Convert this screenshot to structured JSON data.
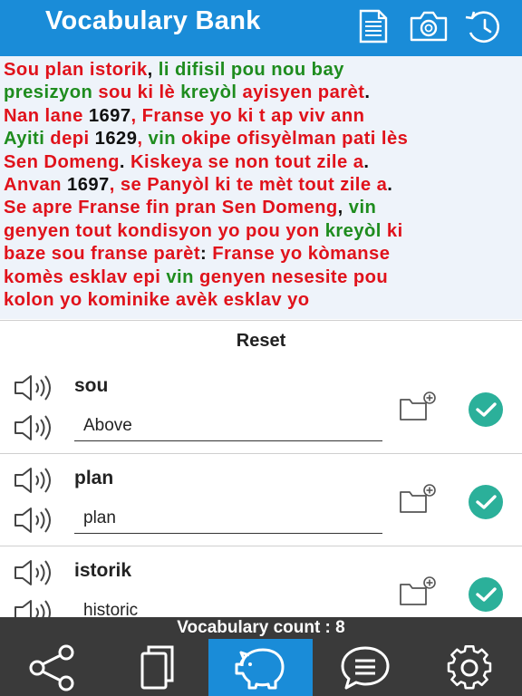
{
  "header": {
    "title": "Vocabulary Bank"
  },
  "passage": [
    [
      [
        "r",
        "Sou plan istorik"
      ],
      [
        "k",
        ", "
      ],
      [
        "g",
        "li difisil pou nou bay"
      ]
    ],
    [
      [
        "g",
        "presizyon"
      ],
      [
        "r",
        " sou ki lè "
      ],
      [
        "g",
        "kreyòl"
      ],
      [
        "r",
        " ayisyen parèt"
      ],
      [
        "k",
        "."
      ]
    ],
    [
      [
        "r",
        "Nan lane "
      ],
      [
        "k",
        "1697"
      ],
      [
        "r",
        ", Franse yo ki t ap viv ann"
      ]
    ],
    [
      [
        "g",
        "Ayiti"
      ],
      [
        "r",
        " depi "
      ],
      [
        "k",
        "1629"
      ],
      [
        "r",
        ", "
      ],
      [
        "g",
        "vin"
      ],
      [
        "r",
        " okipe ofisyèlman pati lès"
      ]
    ],
    [
      [
        "r",
        "Sen Domeng"
      ],
      [
        "k",
        "."
      ],
      [
        "r",
        " Kiskeya se non tout zile a"
      ],
      [
        "k",
        "."
      ]
    ],
    [
      [
        "r",
        "Anvan "
      ],
      [
        "k",
        "1697"
      ],
      [
        "r",
        ", se Panyòl ki te mèt tout zile a"
      ],
      [
        "k",
        "."
      ]
    ],
    [
      [
        "r",
        "Se apre Franse fin pran Sen Domeng"
      ],
      [
        "k",
        ", "
      ],
      [
        "g",
        "vin"
      ]
    ],
    [
      [
        "r",
        "genyen tout kondisyon yo pou yon "
      ],
      [
        "g",
        "kreyòl"
      ],
      [
        "r",
        " ki"
      ]
    ],
    [
      [
        "r",
        "baze sou franse parèt"
      ],
      [
        "k",
        ": "
      ],
      [
        "r",
        "Franse yo kòmanse"
      ]
    ],
    [
      [
        "r",
        "komès esklav epi "
      ],
      [
        "g",
        "vin"
      ],
      [
        "r",
        " genyen nesesite pou"
      ]
    ],
    [
      [
        "r",
        "kolon yo kominike avèk esklav yo"
      ]
    ]
  ],
  "reset_label": "Reset",
  "vocab": [
    {
      "word": "sou",
      "translation": "Above"
    },
    {
      "word": "plan",
      "translation": "plan"
    },
    {
      "word": "istorik",
      "translation": "historic"
    }
  ],
  "count_label": "Vocabulary count : 8",
  "colors": {
    "header": "#1a8cd8",
    "red": "#e0121b",
    "green": "#1e8c1e",
    "check": "#2bb09a",
    "bar": "#3a3a3a"
  },
  "icons": {
    "header": [
      "document-icon",
      "camera-icon",
      "history-icon"
    ],
    "tabs": [
      "share-icon",
      "copy-icon",
      "piggy-bank-icon",
      "chat-icon",
      "gear-icon"
    ]
  }
}
